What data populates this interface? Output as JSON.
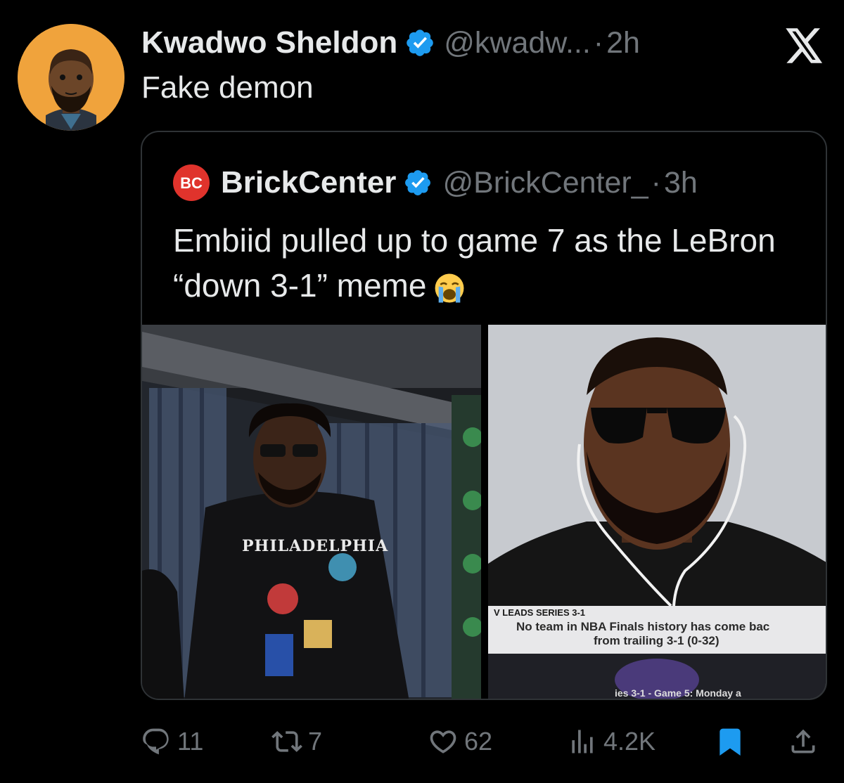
{
  "tweet": {
    "author_name": "Kwadwo Sheldon",
    "handle": "@kwadw...",
    "separator": "·",
    "time": "2h",
    "text": "Fake demon"
  },
  "quoted_tweet": {
    "author_name": "BrickCenter",
    "handle": "@BrickCenter_",
    "separator": "·",
    "time": "3h",
    "text": "Embiid pulled up to game 7 as the LeBron “down 3-1” meme",
    "emoji": "loudly-crying-face",
    "logo_text": "BC",
    "media": {
      "left_shirt_text": "PHILADELPHIA",
      "right_banner_head": "V LEADS SERIES 3-1",
      "right_banner_line1": "No team in NBA Finals history has come bac",
      "right_banner_line2": "from trailing 3-1 (0-32)",
      "right_bottom_text": "ies 3-1 - Game 5: Monday a"
    }
  },
  "actions": {
    "replies": "11",
    "reposts": "7",
    "likes": "62",
    "views": "4.2K"
  },
  "colors": {
    "background": "#000000",
    "text_primary": "#e7e9ea",
    "text_secondary": "#71767b",
    "verified": "#1d9bf0",
    "bookmark": "#1d9bf0",
    "border": "#2f3336"
  },
  "icons": [
    "verified-badge-icon",
    "x-logo-icon",
    "reply-icon",
    "repost-icon",
    "like-icon",
    "views-icon",
    "bookmark-icon",
    "share-icon"
  ]
}
